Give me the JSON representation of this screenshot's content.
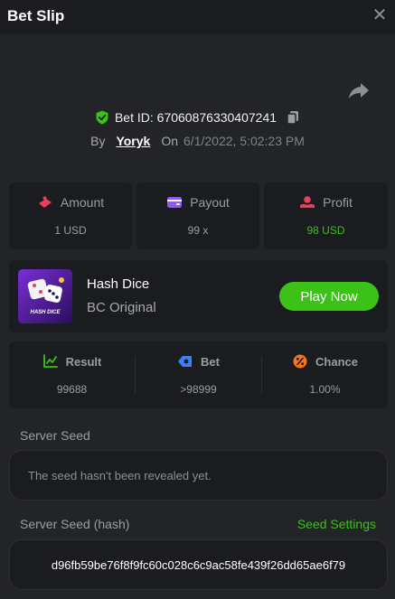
{
  "header": {
    "title": "Bet Slip",
    "close_glyph": "✕"
  },
  "bet": {
    "id_label": "Bet ID: 67060876330407241",
    "by_label": "By",
    "user": "Yoryk",
    "on_label": "On",
    "date": "6/1/2022, 5:02:23 PM"
  },
  "stats": {
    "amount": {
      "label": "Amount",
      "value": "1 USD",
      "icon": "amount-icon"
    },
    "payout": {
      "label": "Payout",
      "value": "99 x",
      "icon": "wallet-icon"
    },
    "profit": {
      "label": "Profit",
      "value": "98 USD",
      "icon": "profit-icon"
    }
  },
  "game": {
    "name": "Hash Dice",
    "provider": "BC Original",
    "thumb_text": "HASH DICE",
    "play_label": "Play Now"
  },
  "result": {
    "result": {
      "label": "Result",
      "value": "99688"
    },
    "bet": {
      "label": "Bet",
      "value": ">98999"
    },
    "chance": {
      "label": "Chance",
      "value": "1.00%"
    }
  },
  "seed": {
    "server_seed_label": "Server Seed",
    "server_seed_value": "The seed hasn't been revealed yet.",
    "hash_label": "Server Seed (hash)",
    "settings_link": "Seed Settings",
    "hash_value": "d96fb59be76f8f9fc60c028c6c9ac58fe439f26dd65ae6f79"
  },
  "colors": {
    "accent": "#3bc117",
    "background": "#232428",
    "card": "#1b1c20",
    "amount_icon": "#e9405a",
    "payout_icon": "#8b5cf6",
    "profit_icon": "#e9405a",
    "bet_icon": "#3b82f6",
    "chance_icon": "#f97316"
  }
}
